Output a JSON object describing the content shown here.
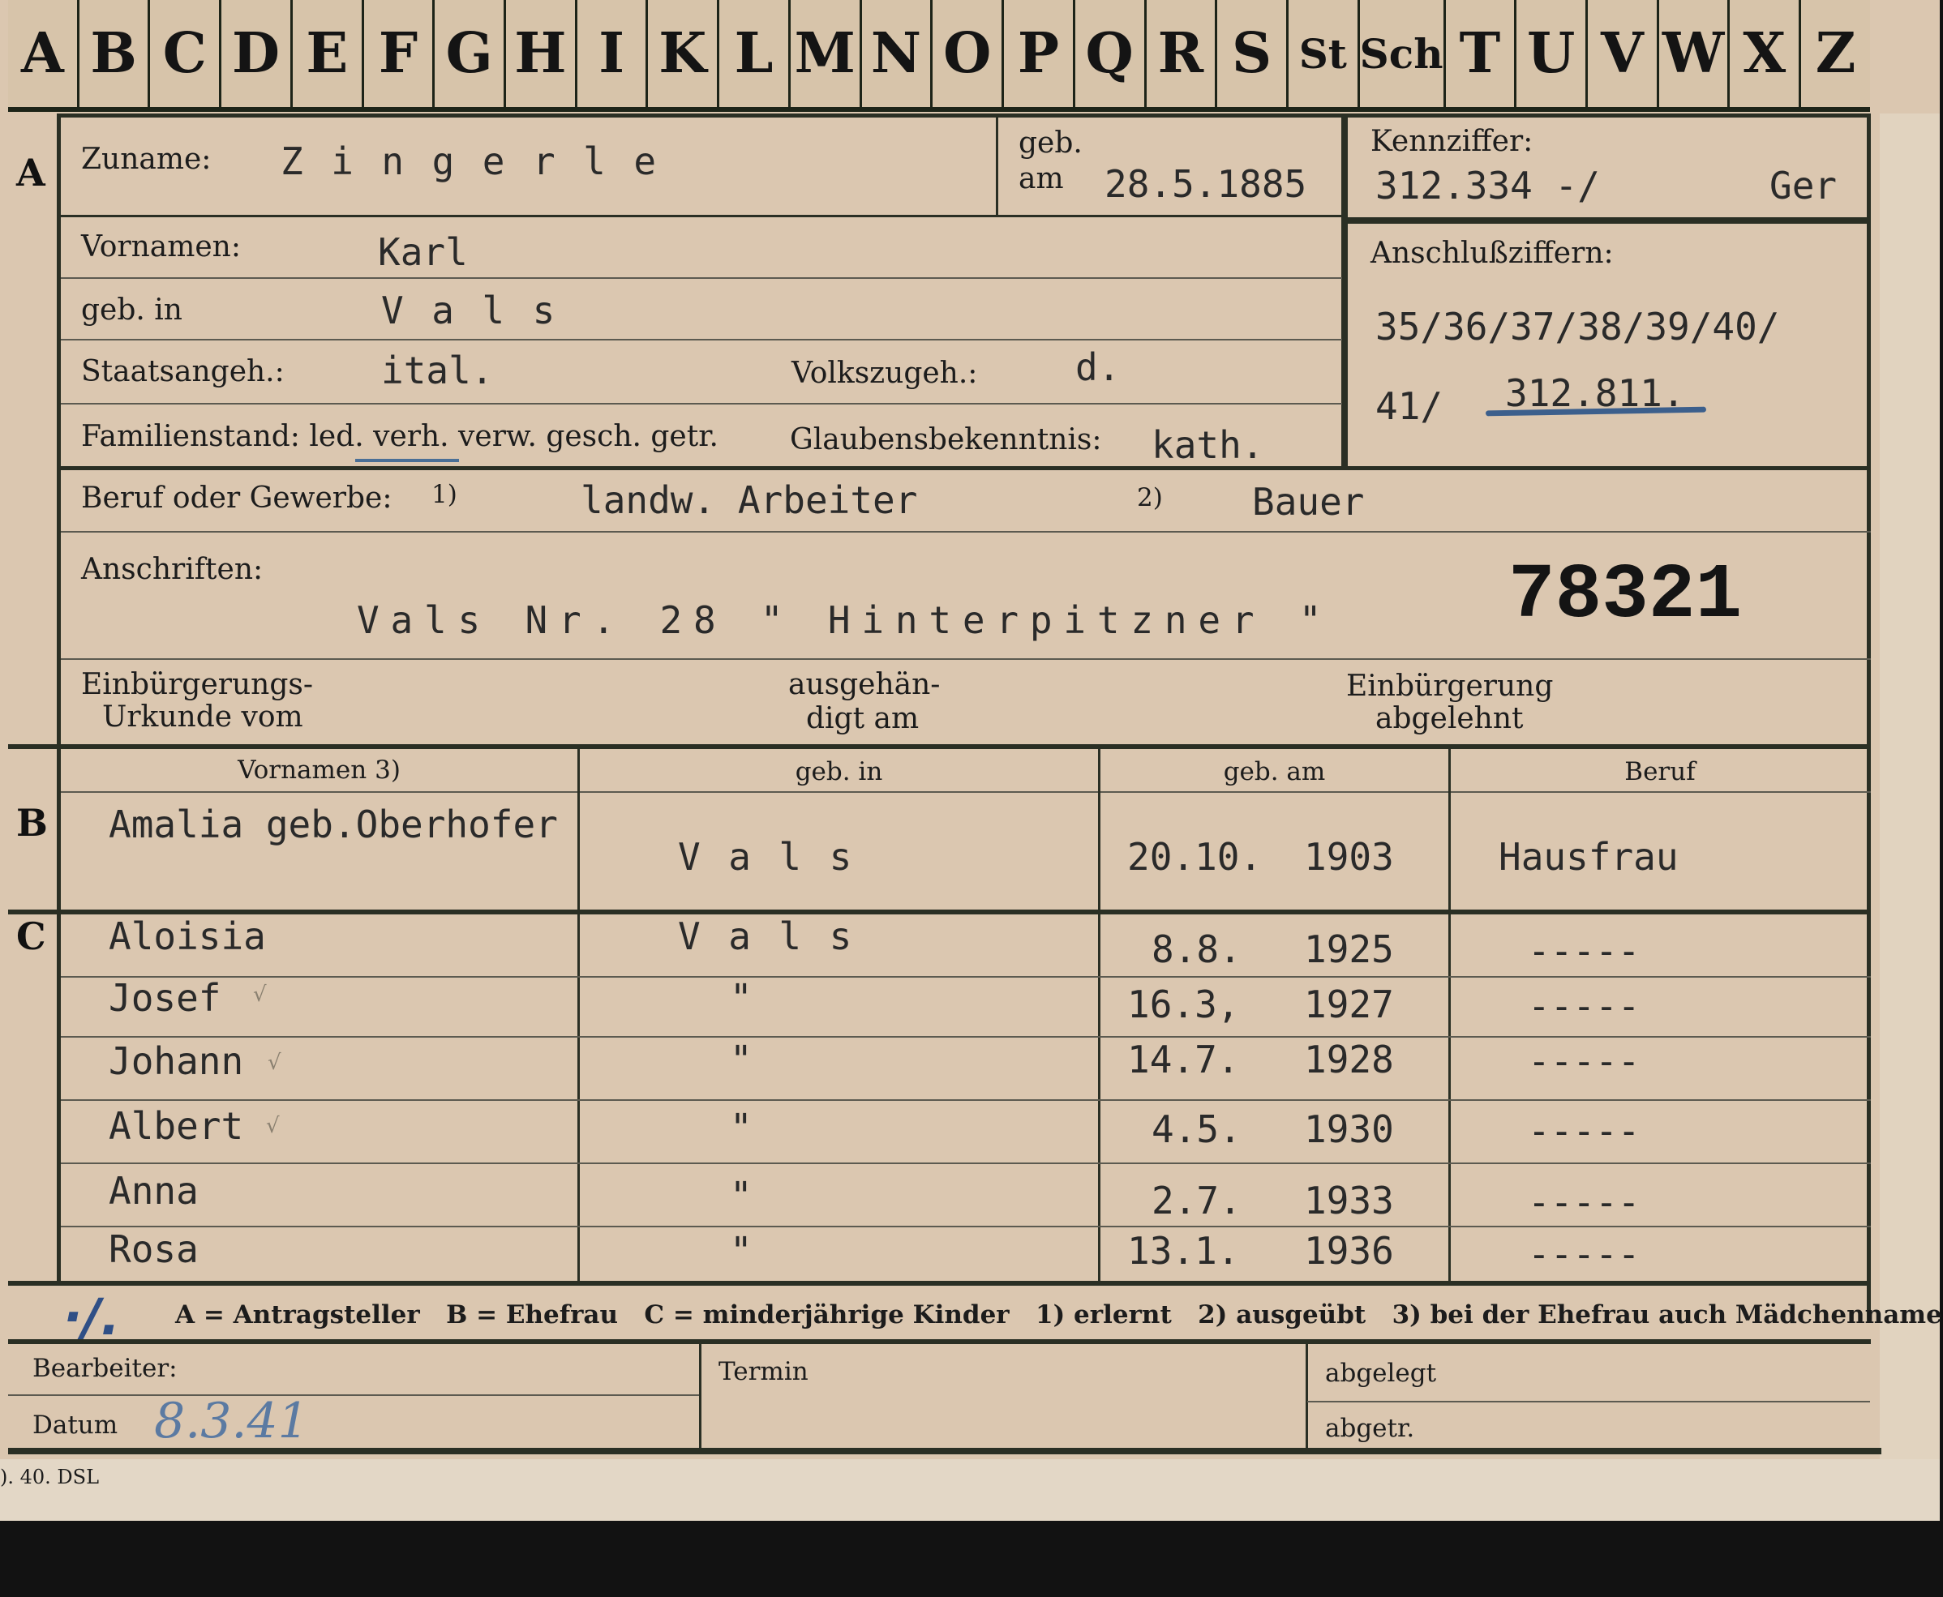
{
  "tab_letters": [
    "A",
    "B",
    "C",
    "D",
    "E",
    "F",
    "G",
    "H",
    "I",
    "K",
    "L",
    "M",
    "N",
    "O",
    "P",
    "Q",
    "R",
    "S",
    "St",
    "Sch",
    "T",
    "U",
    "V",
    "W",
    "X",
    "Z"
  ],
  "row_letters": {
    "a": "A",
    "b": "B",
    "c": "C"
  },
  "applicant": {
    "surname_label": "Zuname:",
    "surname": "Zingerle",
    "dob_label_1": "geb.",
    "dob_label_2": "am",
    "dob": "28.5.1885",
    "first_names_label": "Vornamen:",
    "first_names": "Karl",
    "birthplace_label": "geb. in",
    "birthplace": "Vals",
    "citizenship_label": "Staatsangeh.:",
    "citizenship": "ital.",
    "ethnicity_label": "Volkszugeh.:",
    "ethnicity": "d.",
    "family_status_label": "Familienstand: led. verh. verw. gesch. getr.",
    "religion_label": "Glaubensbekenntnis:",
    "religion": "kath.",
    "occupation_label": "Beruf oder Gewerbe:",
    "occ_note_1": "1)",
    "occupation_1": "landw. Arbeiter",
    "occ_note_2": "2)",
    "occupation_2": "Bauer",
    "address_label": "Anschriften:",
    "address": "Vals Nr. 28 \" Hinterpitzner \"",
    "big_number": "78321",
    "naturalization_doc_label_1": "Einbürgerungs-",
    "naturalization_doc_label_2": "Urkunde vom",
    "handed_out_label_1": "ausgehän-",
    "handed_out_label_2": "digt am",
    "naturalization_denied_label_1": "Einbürgerung",
    "naturalization_denied_label_2": "abgelehnt"
  },
  "reference": {
    "code_label": "Kennziffer:",
    "code": "312.334 -/",
    "code_suffix": "Ger",
    "linked_label": "Anschlußziffern:",
    "linked_line_1": "35/36/37/38/39/40/",
    "linked_line_2_prefix": "41/",
    "linked_line_2_value": "312.811."
  },
  "family_table": {
    "headers": [
      "Vornamen 3)",
      "geb. in",
      "geb. am",
      "Beruf"
    ],
    "spouse": {
      "name": "Amalia geb.Oberhofer",
      "place": "Vals",
      "dob_day": "20.10.",
      "dob_year": "1903",
      "occupation": "Hausfrau"
    },
    "children": [
      {
        "name": "Aloisia",
        "place": "Vals",
        "dob_day": "8.8.",
        "dob_year": "1925",
        "occupation": "-----"
      },
      {
        "name": "Josef",
        "place": "\"",
        "dob_day": "16.3,",
        "dob_year": "1927",
        "occupation": "-----"
      },
      {
        "name": "Johann",
        "place": "\"",
        "dob_day": "14.7.",
        "dob_year": "1928",
        "occupation": "-----"
      },
      {
        "name": "Albert",
        "place": "\"",
        "dob_day": "4.5.",
        "dob_year": "1930",
        "occupation": "-----"
      },
      {
        "name": "Anna",
        "place": "\"",
        "dob_day": "2.7.",
        "dob_year": "1933",
        "occupation": "-----"
      },
      {
        "name": "Rosa",
        "place": "\"",
        "dob_day": "13.1.",
        "dob_year": "1936",
        "occupation": "-----"
      }
    ]
  },
  "legend": {
    "mark": "·/.",
    "text": "A = Antragsteller   B = Ehefrau   C = minderjährige Kinder   1) erlernt   2) ausgeübt   3) bei der Ehefrau auch Mädchenname"
  },
  "footer": {
    "clerk_label": "Bearbeiter:",
    "date_label": "Datum",
    "date_value": "8.3.41",
    "deadline_label": "Termin",
    "filed_label": "abgelegt",
    "filed2_label": "abgetr.",
    "print_code": "). 40. DSL"
  }
}
